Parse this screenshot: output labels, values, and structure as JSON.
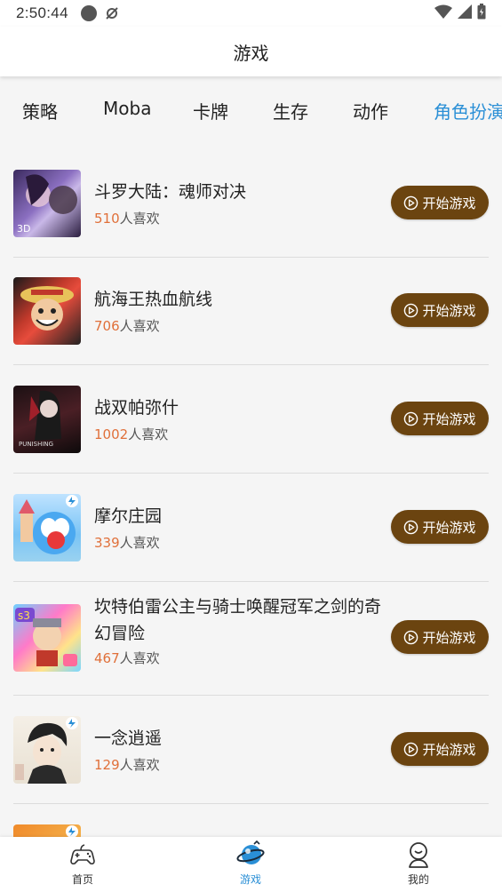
{
  "status_bar": {
    "time": "2:50:44"
  },
  "header": {
    "title": "游戏"
  },
  "tabs": [
    {
      "label": "策略",
      "active": false
    },
    {
      "label": "Moba",
      "active": false
    },
    {
      "label": "卡牌",
      "active": false
    },
    {
      "label": "生存",
      "active": false
    },
    {
      "label": "动作",
      "active": false
    },
    {
      "label": "角色扮演",
      "active": true
    }
  ],
  "play_label": "开始游戏",
  "likes_suffix": "人喜欢",
  "games": [
    {
      "name": "斗罗大陆：魂师对决",
      "likes": "510"
    },
    {
      "name": "航海王热血航线",
      "likes": "706"
    },
    {
      "name": "战双帕弥什",
      "likes": "1002"
    },
    {
      "name": "摩尔庄园",
      "likes": "339"
    },
    {
      "name": "坎特伯雷公主与骑士唤醒冠军之剑的奇幻冒险",
      "likes": "467"
    },
    {
      "name": "一念逍遥",
      "likes": "129"
    }
  ],
  "bottom_nav": [
    {
      "label": "首页",
      "icon": "gamepad-icon",
      "active": false
    },
    {
      "label": "游戏",
      "icon": "game-planet-icon",
      "active": true
    },
    {
      "label": "我的",
      "icon": "user-icon",
      "active": false
    }
  ],
  "colors": {
    "accent": "#2a8fd6",
    "button": "#6b4410",
    "likes_number": "#e0703a"
  }
}
